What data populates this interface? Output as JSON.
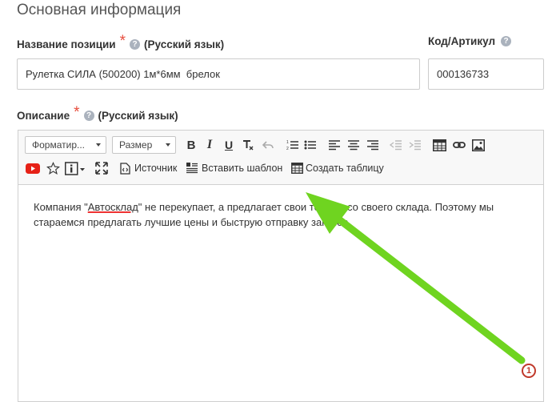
{
  "section": {
    "title": "Основная информация"
  },
  "name_field": {
    "label": "Название позиции",
    "required_mark": "*",
    "help": "?",
    "lang": "(Русский язык)",
    "value": "Рулетка СИЛА (500200) 1м*6мм  брелок"
  },
  "code_field": {
    "label": "Код/Артикул",
    "help": "?",
    "value": "000136733"
  },
  "description_field": {
    "label": "Описание",
    "required_mark": "*",
    "help": "?",
    "lang": "(Русский язык)"
  },
  "toolbar": {
    "format_combo": "Форматир...",
    "size_combo": "Размер",
    "bold": "B",
    "italic": "I",
    "underline": "U",
    "source_label": "Источник",
    "insert_template_label": "Вставить шаблон",
    "create_table_label": "Создать таблицу"
  },
  "editor": {
    "line1_pre": "Компания \"",
    "line1_word": "Автосклад",
    "line1_post": "\" не перекупает, а предлагает свои товары со своего склада. Поэтому мы",
    "line2": "стараемся предлагать лучшие цены и быструю отправку заказов."
  },
  "annotation": {
    "number": "1",
    "arrow_color": "#6fd420"
  },
  "colors": {
    "required": "#e74c3c",
    "youtube": "#e62117",
    "spell_error": "#ee3333"
  }
}
